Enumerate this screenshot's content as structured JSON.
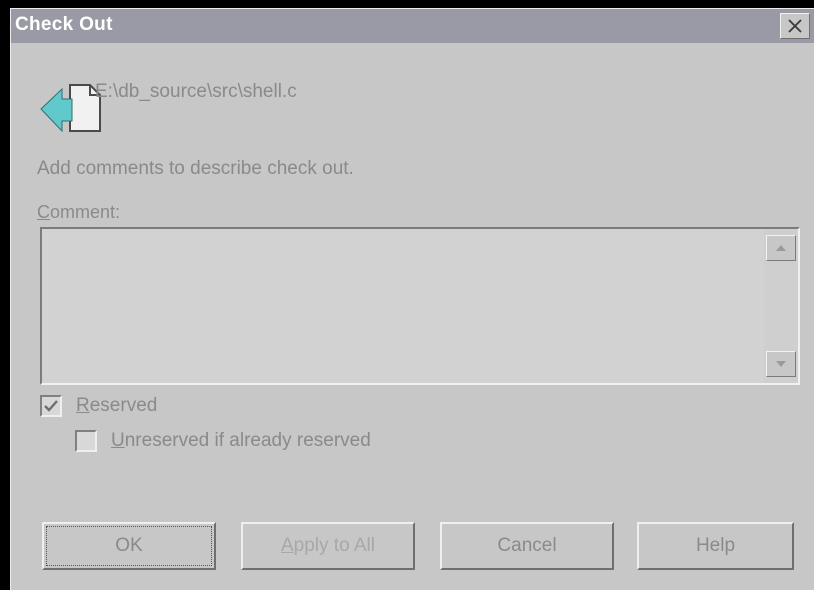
{
  "window": {
    "title": "Check Out"
  },
  "file": {
    "path": "E:\\db_source\\src\\shell.c"
  },
  "description": "Add comments to describe check out.",
  "comment": {
    "label_mnemonic": "C",
    "label_rest": "omment:",
    "value": ""
  },
  "options": {
    "reserved": {
      "mnemonic": "R",
      "rest": "eserved",
      "checked": true
    },
    "unreserved": {
      "mnemonic": "U",
      "rest": "nreserved if already reserved",
      "checked": false
    }
  },
  "buttons": {
    "ok": "OK",
    "apply_mnemonic": "A",
    "apply_rest": "pply to All",
    "cancel": "Cancel",
    "help": "Help"
  },
  "icons": {
    "file": "checkout-file-icon",
    "close": "close-icon",
    "scroll_up": "arrow-up-icon",
    "scroll_down": "arrow-down-icon",
    "check": "check-icon"
  },
  "colors": {
    "dialog_face": "#c7c7c7",
    "titlebar": "#9a9aa7",
    "arrow_accent": "#5fc9cc"
  }
}
